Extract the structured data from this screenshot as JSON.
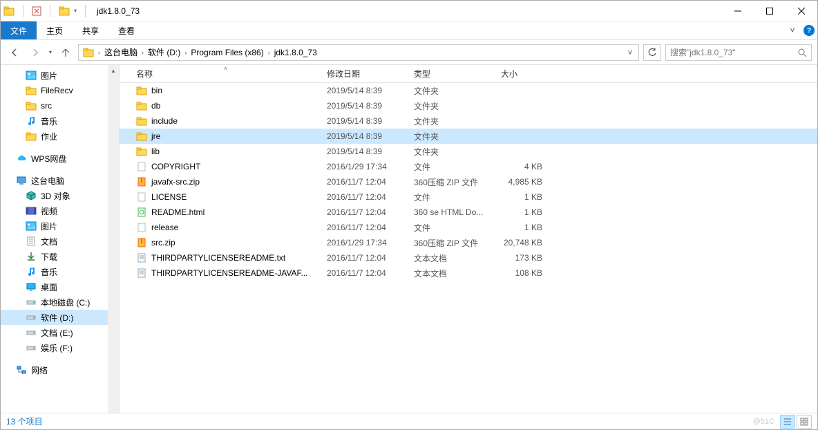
{
  "title": "jdk1.8.0_73",
  "menubar": {
    "file": "文件",
    "home": "主页",
    "share": "共享",
    "view": "查看"
  },
  "breadcrumbs": [
    "这台电脑",
    "软件 (D:)",
    "Program Files (x86)",
    "jdk1.8.0_73"
  ],
  "search_placeholder": "搜索\"jdk1.8.0_73\"",
  "columns": {
    "name": "名称",
    "date": "修改日期",
    "type": "类型",
    "size": "大小"
  },
  "sidebar": {
    "group1": [
      {
        "label": "图片",
        "icon": "pictures"
      },
      {
        "label": "FileRecv",
        "icon": "folder"
      },
      {
        "label": "src",
        "icon": "folder"
      },
      {
        "label": "音乐",
        "icon": "music"
      },
      {
        "label": "作业",
        "icon": "folder"
      }
    ],
    "wps": {
      "label": "WPS网盘",
      "icon": "cloud"
    },
    "thispc": {
      "label": "这台电脑",
      "icon": "pc"
    },
    "thispc_children": [
      {
        "label": "3D 对象",
        "icon": "3d"
      },
      {
        "label": "视频",
        "icon": "video"
      },
      {
        "label": "图片",
        "icon": "pictures"
      },
      {
        "label": "文档",
        "icon": "docs"
      },
      {
        "label": "下载",
        "icon": "downloads"
      },
      {
        "label": "音乐",
        "icon": "music"
      },
      {
        "label": "桌面",
        "icon": "desktop"
      },
      {
        "label": "本地磁盘 (C:)",
        "icon": "drive"
      },
      {
        "label": "软件 (D:)",
        "icon": "drive",
        "selected": true
      },
      {
        "label": "文档 (E:)",
        "icon": "drive"
      },
      {
        "label": "娱乐 (F:)",
        "icon": "drive"
      }
    ],
    "network": {
      "label": "网络",
      "icon": "network"
    }
  },
  "files": [
    {
      "name": "bin",
      "date": "2019/5/14 8:39",
      "type": "文件夹",
      "size": "",
      "icon": "folder"
    },
    {
      "name": "db",
      "date": "2019/5/14 8:39",
      "type": "文件夹",
      "size": "",
      "icon": "folder"
    },
    {
      "name": "include",
      "date": "2019/5/14 8:39",
      "type": "文件夹",
      "size": "",
      "icon": "folder"
    },
    {
      "name": "jre",
      "date": "2019/5/14 8:39",
      "type": "文件夹",
      "size": "",
      "icon": "folder",
      "selected": true
    },
    {
      "name": "lib",
      "date": "2019/5/14 8:39",
      "type": "文件夹",
      "size": "",
      "icon": "folder"
    },
    {
      "name": "COPYRIGHT",
      "date": "2016/1/29 17:34",
      "type": "文件",
      "size": "4 KB",
      "icon": "file"
    },
    {
      "name": "javafx-src.zip",
      "date": "2016/11/7 12:04",
      "type": "360压缩 ZIP 文件",
      "size": "4,985 KB",
      "icon": "zip"
    },
    {
      "name": "LICENSE",
      "date": "2016/11/7 12:04",
      "type": "文件",
      "size": "1 KB",
      "icon": "file"
    },
    {
      "name": "README.html",
      "date": "2016/11/7 12:04",
      "type": "360 se HTML Do...",
      "size": "1 KB",
      "icon": "html"
    },
    {
      "name": "release",
      "date": "2016/11/7 12:04",
      "type": "文件",
      "size": "1 KB",
      "icon": "file"
    },
    {
      "name": "src.zip",
      "date": "2016/1/29 17:34",
      "type": "360压缩 ZIP 文件",
      "size": "20,748 KB",
      "icon": "zip"
    },
    {
      "name": "THIRDPARTYLICENSEREADME.txt",
      "date": "2016/11/7 12:04",
      "type": "文本文档",
      "size": "173 KB",
      "icon": "txt"
    },
    {
      "name": "THIRDPARTYLICENSEREADME-JAVAF...",
      "date": "2016/11/7 12:04",
      "type": "文本文档",
      "size": "108 KB",
      "icon": "txt"
    }
  ],
  "status": "13 个项目",
  "watermark": "@51C"
}
